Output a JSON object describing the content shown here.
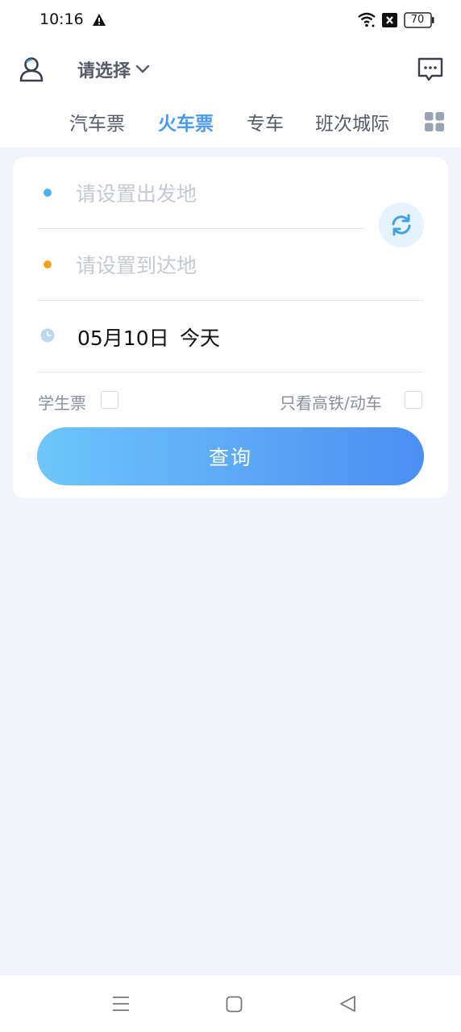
{
  "status_bar": {
    "time": "10:16",
    "battery": "70",
    "icons": [
      "warning-icon",
      "wifi-icon",
      "close-box-icon",
      "battery-icon"
    ]
  },
  "header": {
    "city_select": "请选择",
    "avatar_icon": "user-icon",
    "message_icon": "message-icon"
  },
  "tabs": [
    {
      "label": "汽车票",
      "active": false
    },
    {
      "label": "火车票",
      "active": true
    },
    {
      "label": "专车",
      "active": false
    },
    {
      "label": "班次城际",
      "active": false
    }
  ],
  "more_icon": "grid-icon",
  "form": {
    "from_placeholder": "请设置出发地",
    "from_value": "",
    "to_placeholder": "请设置到达地",
    "to_value": "",
    "swap_icon": "swap-refresh-icon",
    "date": "05月10日",
    "date_day": "今天",
    "student_ticket_label": "学生票",
    "student_ticket_checked": false,
    "high_speed_label": "只看高铁/动车",
    "high_speed_checked": false,
    "query_button": "查询"
  },
  "colors": {
    "accent": "#4a9bef",
    "from_dot": "#47b3f0",
    "to_dot": "#f7a21b",
    "background": "#f1f5fb"
  },
  "nav_bar": {
    "icons": [
      "menu-icon",
      "home-square-icon",
      "back-triangle-icon"
    ]
  }
}
